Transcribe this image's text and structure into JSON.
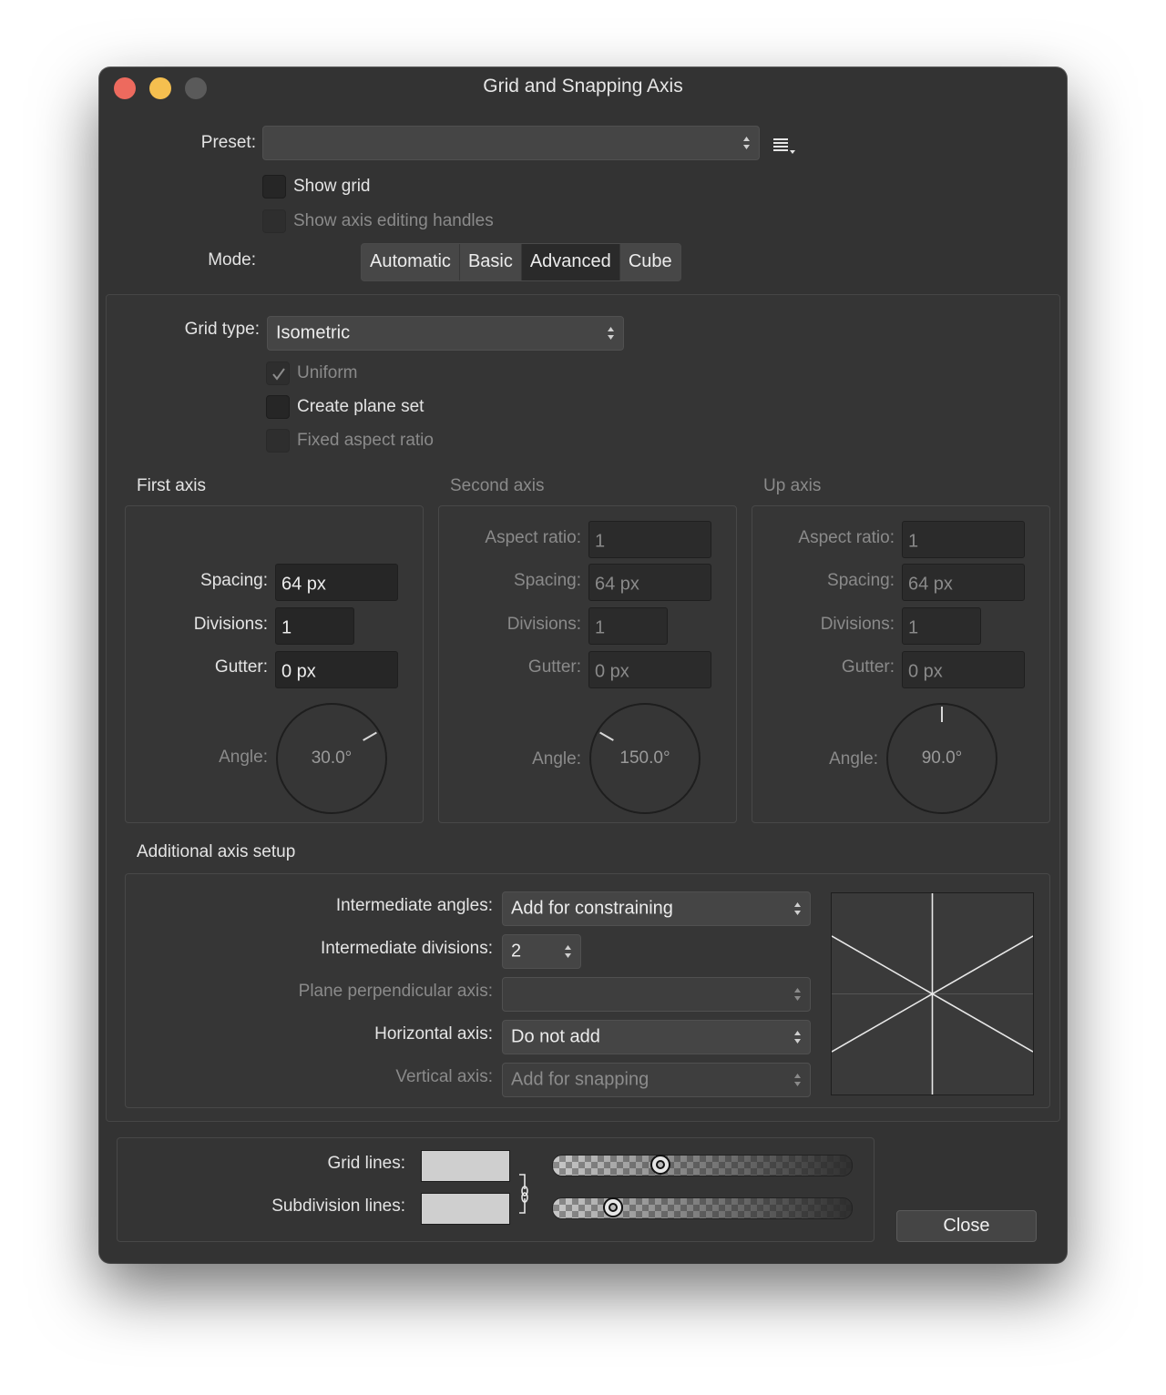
{
  "window": {
    "title": "Grid and Snapping Axis"
  },
  "preset": {
    "label": "Preset:",
    "value": ""
  },
  "show_grid": {
    "label": "Show grid",
    "checked": false
  },
  "show_axis_handles": {
    "label": "Show axis editing handles",
    "checked": false
  },
  "mode": {
    "label": "Mode:",
    "options": [
      "Automatic",
      "Basic",
      "Advanced",
      "Cube"
    ],
    "selected": "Advanced"
  },
  "grid_type": {
    "label": "Grid type:",
    "value": "Isometric"
  },
  "uniform": {
    "label": "Uniform",
    "checked": true
  },
  "create_plane_set": {
    "label": "Create plane set",
    "checked": false
  },
  "fixed_aspect": {
    "label": "Fixed aspect ratio",
    "checked": false
  },
  "axes": {
    "first": {
      "title": "First axis",
      "spacing_label": "Spacing:",
      "spacing": "64 px",
      "divisions_label": "Divisions:",
      "divisions": "1",
      "gutter_label": "Gutter:",
      "gutter": "0 px",
      "angle_label": "Angle:",
      "angle": "30.0°",
      "angle_deg": 30
    },
    "second": {
      "title": "Second axis",
      "aspect_label": "Aspect ratio:",
      "aspect": "1",
      "spacing_label": "Spacing:",
      "spacing": "64 px",
      "divisions_label": "Divisions:",
      "divisions": "1",
      "gutter_label": "Gutter:",
      "gutter": "0 px",
      "angle_label": "Angle:",
      "angle": "150.0°",
      "angle_deg": 150
    },
    "up": {
      "title": "Up axis",
      "aspect_label": "Aspect ratio:",
      "aspect": "1",
      "spacing_label": "Spacing:",
      "spacing": "64 px",
      "divisions_label": "Divisions:",
      "divisions": "1",
      "gutter_label": "Gutter:",
      "gutter": "0 px",
      "angle_label": "Angle:",
      "angle": "90.0°",
      "angle_deg": 90
    }
  },
  "additional": {
    "title": "Additional axis setup",
    "intermediate_angles_label": "Intermediate angles:",
    "intermediate_angles": "Add for constraining",
    "intermediate_divisions_label": "Intermediate divisions:",
    "intermediate_divisions": "2",
    "plane_perp_label": "Plane perpendicular axis:",
    "plane_perp": "",
    "horizontal_label": "Horizontal axis:",
    "horizontal": "Do not add",
    "vertical_label": "Vertical axis:",
    "vertical": "Add for snapping"
  },
  "lines": {
    "grid_label": "Grid lines:",
    "grid_opacity": 0.36,
    "subdivision_label": "Subdivision lines:",
    "subdivision_opacity": 0.2
  },
  "close_label": "Close",
  "colors": {
    "close": "#ed6a5e",
    "minimize": "#f5bf4f",
    "zoom_inactive": "#5a5a5a",
    "window_bg": "#333333"
  }
}
